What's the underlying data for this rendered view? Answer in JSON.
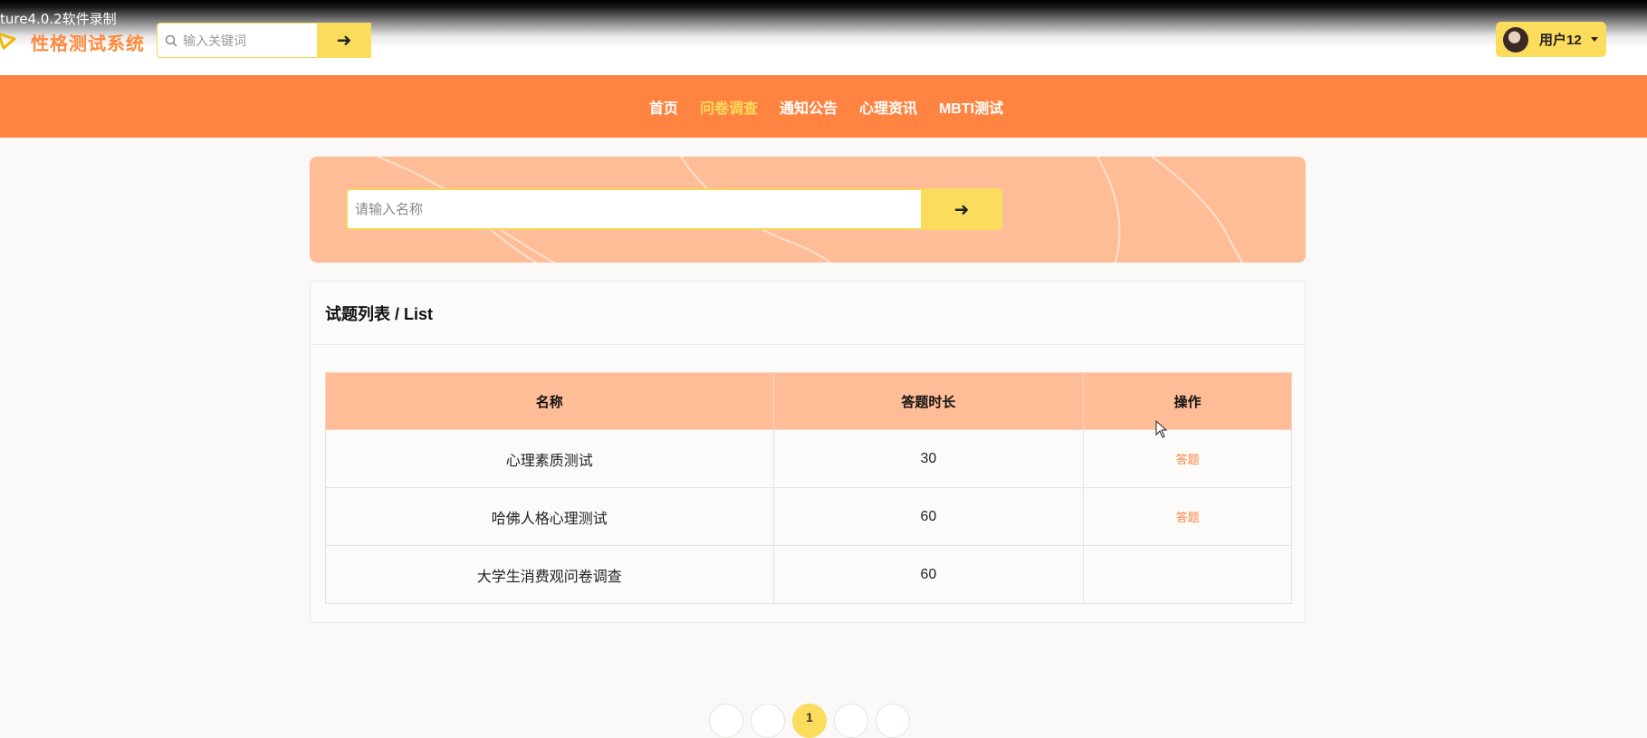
{
  "recorder_label": "ture4.0.2软件录制",
  "header": {
    "logo_text": "性格测试系统",
    "search_placeholder": "输入关键词",
    "search_button_icon": "arrow-right-icon",
    "user_name": "用户12"
  },
  "nav": {
    "items": [
      {
        "label": "首页"
      },
      {
        "label": "问卷调查"
      },
      {
        "label": "通知公告"
      },
      {
        "label": "心理资讯"
      },
      {
        "label": "MBTI测试"
      }
    ],
    "active_index": 1
  },
  "banner": {
    "search_placeholder": "请输入名称"
  },
  "list": {
    "title": "试题列表 / List",
    "columns": [
      "名称",
      "答题时长",
      "操作"
    ],
    "rows": [
      {
        "name": "心理素质测试",
        "duration": "30",
        "action": "答题"
      },
      {
        "name": "哈佛人格心理测试",
        "duration": "60",
        "action": "答题"
      },
      {
        "name": "大学生消费观问卷调查",
        "duration": "60",
        "action": ""
      }
    ]
  },
  "pagination": {
    "current_page": "1"
  },
  "colors": {
    "accent_orange": "#ff8442",
    "accent_yellow": "#fbdc5c",
    "banner_peach": "#ffbd97"
  }
}
